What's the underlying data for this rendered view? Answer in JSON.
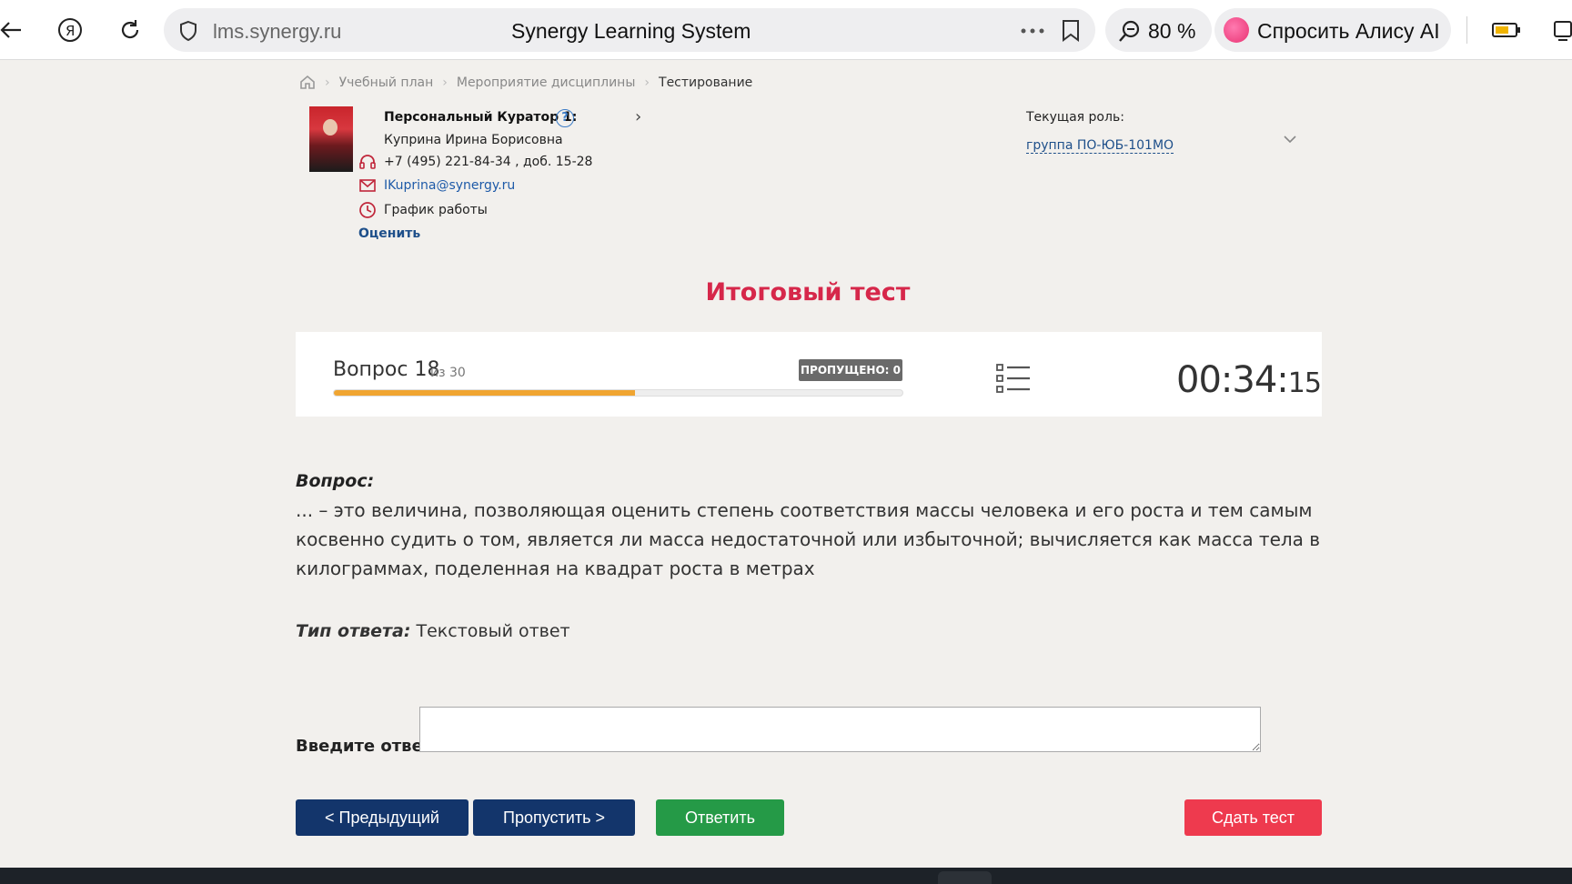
{
  "browser": {
    "url": "lms.synergy.ru",
    "page_title": "Synergy Learning System",
    "zoom": "80 %",
    "alice_label": "Спросить Алису AI"
  },
  "breadcrumb": {
    "items": [
      "Учебный план",
      "Мероприятие дисциплины",
      "Тестирование"
    ]
  },
  "curator": {
    "title": "Персональный Куратор 1:",
    "name": "Куприна Ирина Борисовна",
    "phone": "+7 (495) 221-84-34 , доб. 15-28",
    "email": "IKuprina@synergy.ru",
    "schedule": "График работы",
    "rate": "Оценить"
  },
  "role": {
    "label": "Текущая роль:",
    "value": "группа ПО-ЮБ-101МО"
  },
  "test": {
    "title": "Итоговый тест",
    "question_label": "Вопрос 18",
    "question_of": "из 30",
    "progress": 0.53,
    "skipped": "ПРОПУЩЕНО: 0",
    "timer_main": "00:34:",
    "timer_sec": "15"
  },
  "question": {
    "heading": "Вопрос:",
    "text": "... – это величина, позволяющая оценить степень соответствия массы человека и его роста и тем самым косвенно судить о том, является ли масса недостаточной или избыточной; вычисляется как масса тела в килограммах, поделенная на квадрат роста в метрах",
    "answer_type_label": "Тип ответа:",
    "answer_type_value": "Текстовый ответ",
    "enter_label": "Введите ответ:",
    "answer_value": ""
  },
  "buttons": {
    "prev": "< Предыдущий",
    "skip": "Пропустить >",
    "answer": "Ответить",
    "submit": "Сдать тест"
  },
  "colors": {
    "accent_red": "#d6274a",
    "nav_blue": "#13356b",
    "answer_green": "#259a47",
    "submit_red": "#ee3a4e",
    "progress_orange": "#f0a531"
  }
}
